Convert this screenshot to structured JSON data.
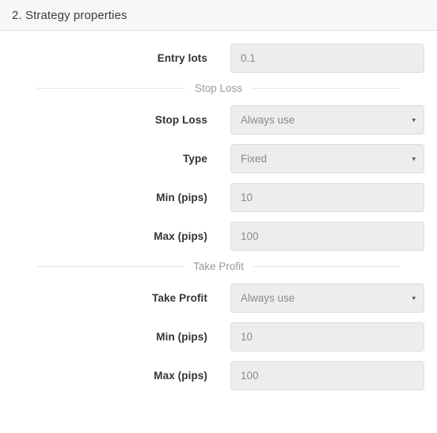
{
  "panel": {
    "title": "2. Strategy properties"
  },
  "form": {
    "entry_lots": {
      "label": "Entry lots",
      "value": "0.1",
      "type": "text"
    },
    "stop_loss_divider": "Stop Loss",
    "stop_loss_mode": {
      "label": "Stop Loss",
      "value": "Always use",
      "type": "select"
    },
    "stop_loss_type": {
      "label": "Type",
      "value": "Fixed",
      "type": "select"
    },
    "stop_loss_min": {
      "label": "Min (pips)",
      "value": "10",
      "type": "text"
    },
    "stop_loss_max": {
      "label": "Max (pips)",
      "value": "100",
      "type": "text"
    },
    "take_profit_divider": "Take Profit",
    "take_profit_mode": {
      "label": "Take Profit",
      "value": "Always use",
      "type": "select"
    },
    "take_profit_min": {
      "label": "Min (pips)",
      "value": "10",
      "type": "text"
    },
    "take_profit_max": {
      "label": "Max (pips)",
      "value": "100",
      "type": "text"
    }
  },
  "icons": {
    "chevron_down": "▾"
  },
  "colors": {
    "header_bg": "#f7f7f7",
    "field_bg": "#ededed",
    "field_border": "#dcdcdc",
    "label_text": "#333333",
    "value_text": "#8a8a8a",
    "divider_line": "#e4e4e6",
    "divider_text": "#9a9a9f"
  }
}
